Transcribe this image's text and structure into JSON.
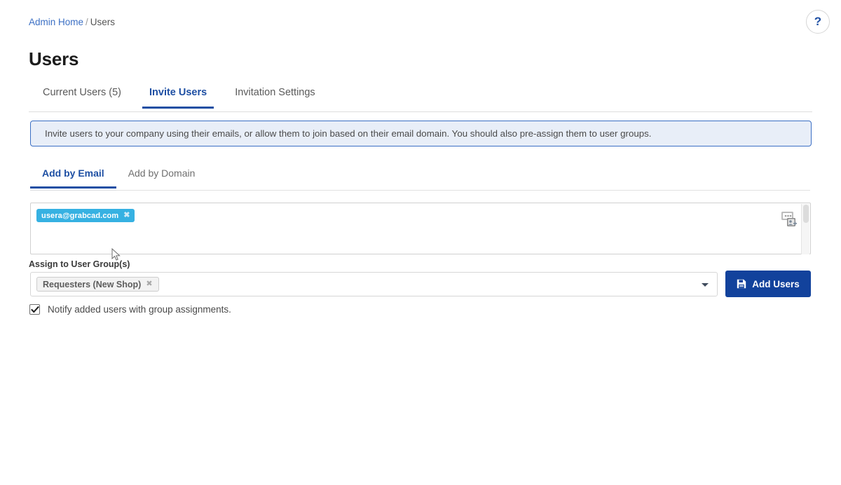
{
  "breadcrumb": {
    "home_label": "Admin Home",
    "separator": "/",
    "current_label": "Users"
  },
  "header": {
    "title": "Users",
    "help_icon": "question-mark-icon",
    "help_label": "?"
  },
  "primary_tabs": [
    {
      "label": "Current Users (5)",
      "active": false
    },
    {
      "label": "Invite Users",
      "active": true
    },
    {
      "label": "Invitation Settings",
      "active": false
    }
  ],
  "info_banner": {
    "text": "Invite users to your company using their emails, or allow them to join based on their email domain. You should also pre-assign them to user groups."
  },
  "secondary_tabs": [
    {
      "label": "Add by Email",
      "active": true
    },
    {
      "label": "Add by Domain",
      "active": false
    }
  ],
  "email_entry": {
    "chips": [
      {
        "label": "usera@grabcad.com",
        "remove_label": "✖"
      }
    ],
    "placeholder": "",
    "contacts_icon": "contacts-add-icon",
    "scrollbar": "vertical-scrollbar"
  },
  "assign_group": {
    "label": "Assign to User Group(s)",
    "chips": [
      {
        "label": "Requesters (New Shop)",
        "remove_label": "✖"
      }
    ],
    "caret_icon": "chevron-down-icon"
  },
  "add_users": {
    "label": "Add Users",
    "icon": "save-floppy-icon"
  },
  "notify": {
    "checked": true,
    "check_glyph": "✔",
    "label": "Notify added users with group assignments."
  },
  "colors": {
    "brand_blue": "#1e4fa3",
    "button_blue": "#12429c",
    "link_blue": "#3b6fc4",
    "banner_bg": "#e8eef8",
    "email_chip": "#36b1e2",
    "group_chip": "#f2f2f2"
  }
}
